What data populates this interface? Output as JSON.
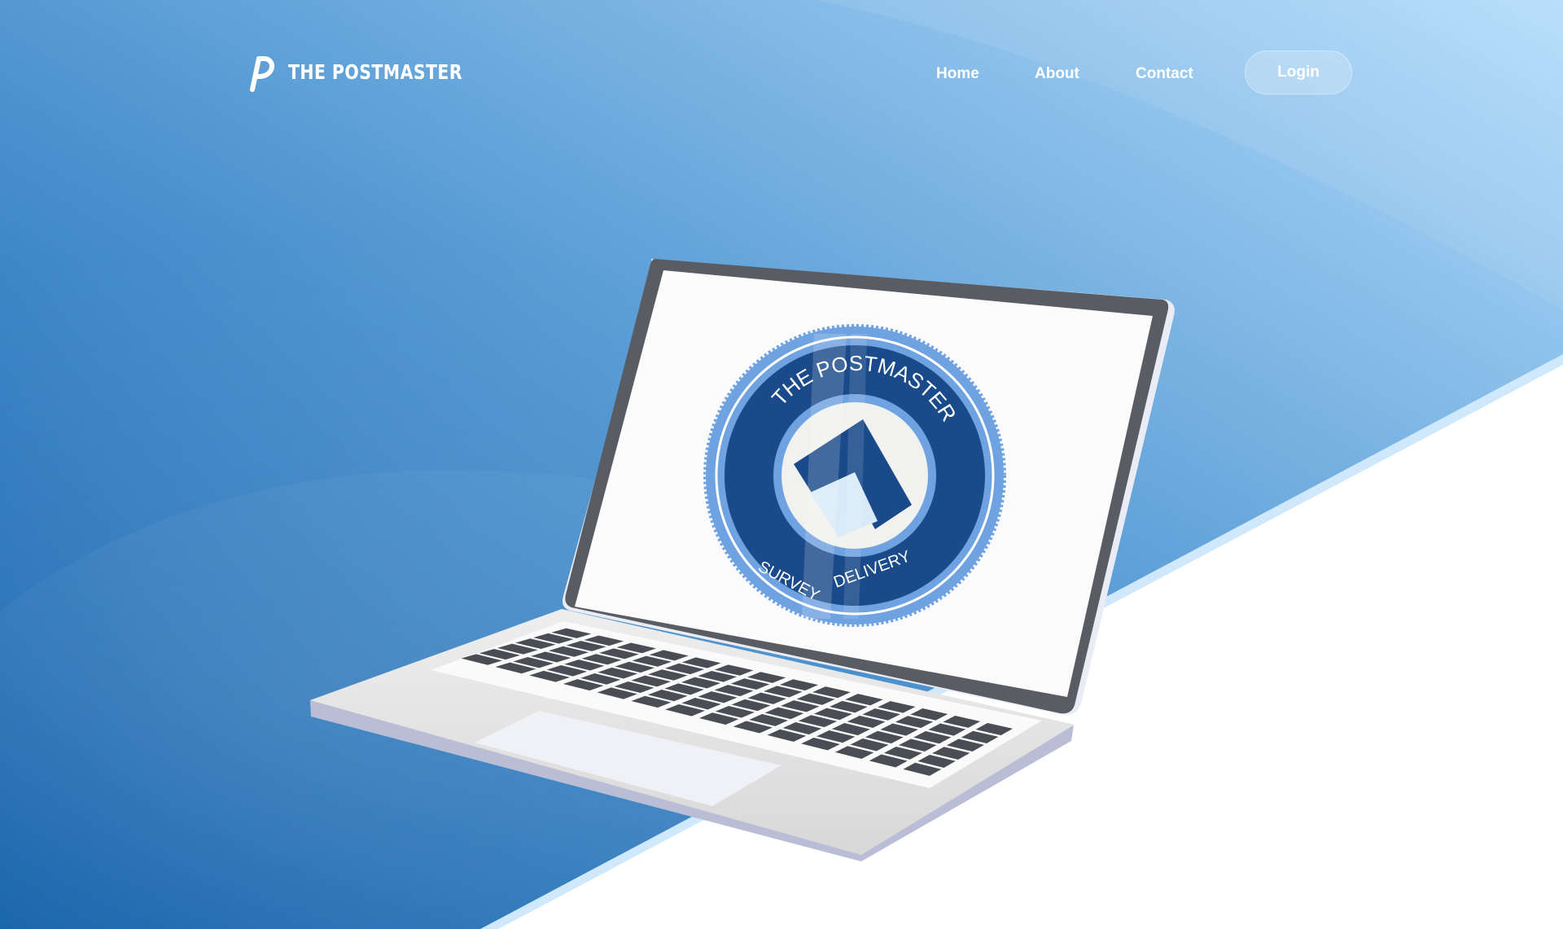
{
  "brand": {
    "name": "THE POSTMASTER",
    "logo_letter": "P"
  },
  "nav": {
    "items": [
      "Home",
      "About",
      "Contact"
    ],
    "login_label": "Login"
  },
  "screen_badge": {
    "top_text": "THE POSTMASTER",
    "left_text": "SURVEY",
    "right_text": "DELIVERY"
  },
  "colors": {
    "bg_dark": "#0a5aa6",
    "bg_light": "#a9d6f7",
    "badge_dark": "#1a4a8a",
    "badge_light": "#6ea2e0",
    "laptop_frame": "#5a5c63",
    "keyboard_key": "#4b4d55"
  }
}
